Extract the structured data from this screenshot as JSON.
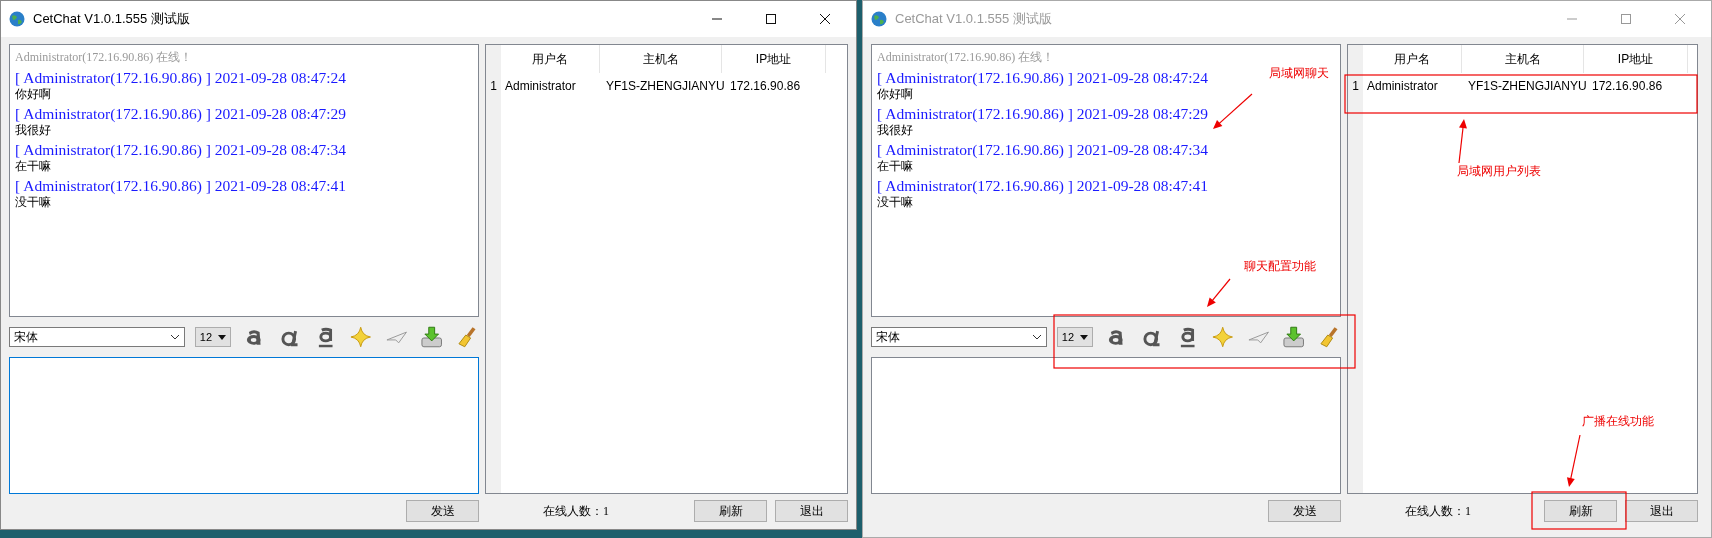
{
  "windows": [
    {
      "title": "CetChat V1.0.1.555 测试版",
      "active": true,
      "chat": {
        "status_line": "Administrator(172.16.90.86) 在线！",
        "messages": [
          {
            "header": "[ Administrator(172.16.90.86) ] 2021-09-28 08:47:24",
            "text": "你好啊"
          },
          {
            "header": "[ Administrator(172.16.90.86) ] 2021-09-28 08:47:29",
            "text": "我很好"
          },
          {
            "header": "[ Administrator(172.16.90.86) ] 2021-09-28 08:47:34",
            "text": "在干嘛"
          },
          {
            "header": "[ Administrator(172.16.90.86) ] 2021-09-28 08:47:41",
            "text": "没干嘛"
          }
        ]
      },
      "user_table": {
        "columns": [
          "用户名",
          "主机名",
          "IP地址"
        ],
        "rows": [
          {
            "index": "1",
            "cells": [
              "Administrator",
              "YF1S-ZHENGJIANYU",
              "172.16.90.86"
            ]
          }
        ]
      },
      "font_select": {
        "value": "宋体"
      },
      "size_select": {
        "value": "12"
      },
      "send_button": "发送",
      "online_count": "在线人数：1",
      "buttons": [
        "刷新",
        "退出"
      ]
    },
    {
      "title": "CetChat V1.0.1.555 测试版",
      "active": false,
      "chat": {
        "status_line": "Administrator(172.16.90.86) 在线！",
        "messages": [
          {
            "header": "[ Administrator(172.16.90.86) ] 2021-09-28 08:47:24",
            "text": "你好啊"
          },
          {
            "header": "[ Administrator(172.16.90.86) ] 2021-09-28 08:47:29",
            "text": "我很好"
          },
          {
            "header": "[ Administrator(172.16.90.86) ] 2021-09-28 08:47:34",
            "text": "在干嘛"
          },
          {
            "header": "[ Administrator(172.16.90.86) ] 2021-09-28 08:47:41",
            "text": "没干嘛"
          }
        ]
      },
      "user_table": {
        "columns": [
          "用户名",
          "主机名",
          "IP地址"
        ],
        "rows": [
          {
            "index": "1",
            "cells": [
              "Administrator",
              "YF1S-ZHENGJIANYU",
              "172.16.90.86"
            ]
          }
        ]
      },
      "font_select": {
        "value": "宋体"
      },
      "size_select": {
        "value": "12"
      },
      "send_button": "发送",
      "online_count": "在线人数：1",
      "buttons": [
        "刷新",
        "退出"
      ],
      "annotations": [
        {
          "text": "局域网聊天"
        },
        {
          "text": "局域网用户列表"
        },
        {
          "text": "聊天配置功能"
        },
        {
          "text": "广播在线功能"
        }
      ]
    }
  ]
}
